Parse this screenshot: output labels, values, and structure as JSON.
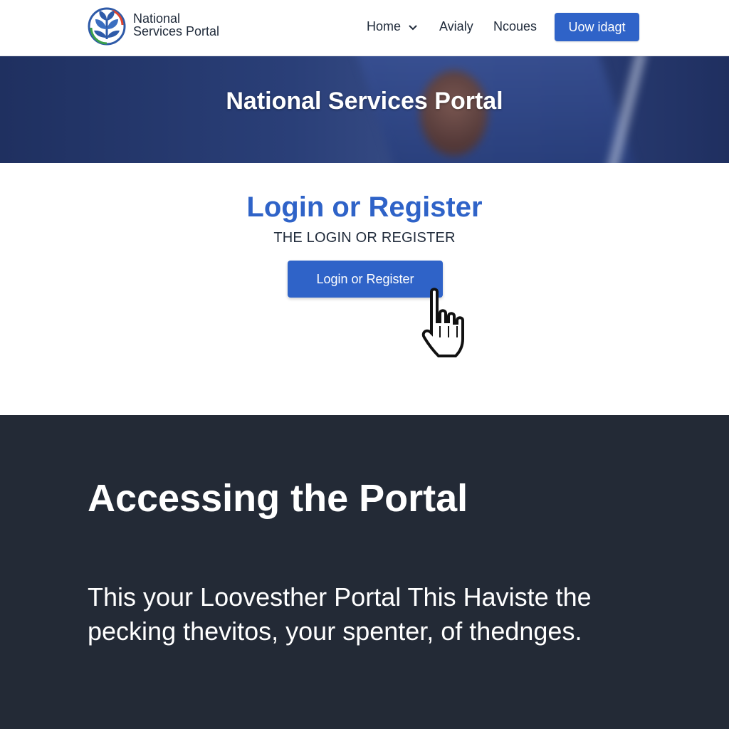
{
  "header": {
    "brand_line1": "National",
    "brand_line2": "Services Portal",
    "nav": {
      "home_label": "Home",
      "item2_label": "Avialy",
      "item3_label": "Ncoues",
      "cta_label": "Uow idagt"
    }
  },
  "hero": {
    "title": "National Services Portal"
  },
  "login": {
    "title": "Login or Register",
    "subtitle": "THE LOGIN OR REGISTER",
    "button_label": "Login or Register"
  },
  "info": {
    "title": "Accessing the Portal",
    "body": "This your Loovesther Portal This Haviste the pecking thevitos, your spenter, of thednges."
  },
  "colors": {
    "accent_blue": "#2f63c8",
    "dark_section": "#232a36",
    "hero_navy": "#1f3060"
  },
  "icons": {
    "logo": "leaf-emblem-icon",
    "home_dropdown": "chevron-down-icon",
    "pointer": "hand-pointer-cursor-icon"
  }
}
